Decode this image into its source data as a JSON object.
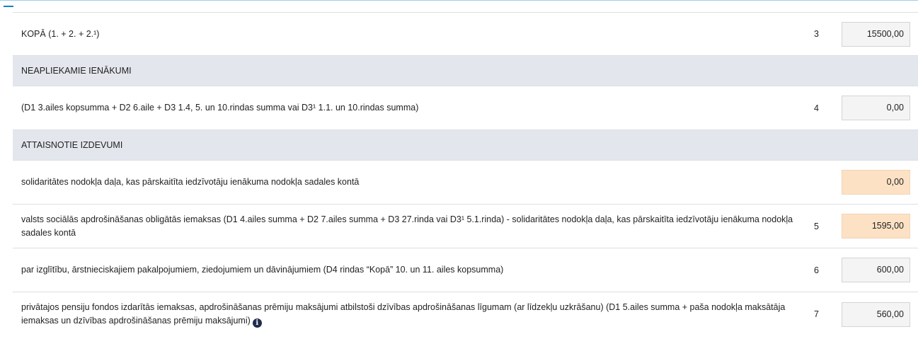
{
  "rows": [
    {
      "kind": "data",
      "label": "KOPĀ (1. + 2. + 2.¹)",
      "num": "3",
      "value": "15500,00"
    },
    {
      "kind": "section",
      "label": "NEAPLIEKAMIE IENĀKUMI"
    },
    {
      "kind": "data",
      "label": "(D1 3.ailes kopsumma + D2 6.aile + D3 1.4, 5. un 10.rindas summa vai D3¹ 1.1. un 10.rindas summa)",
      "num": "4",
      "value": "0,00"
    },
    {
      "kind": "section",
      "label": "ATTAISNOTIE IZDEVUMI"
    },
    {
      "kind": "data",
      "label": "solidaritātes nodokļa daļa, kas pārskaitīta iedzīvotāju ienākuma nodokļa sadales kontā",
      "num": "",
      "value": "0,00"
    },
    {
      "kind": "data",
      "label": "valsts sociālās apdrošināšanas obligātās iemaksas (D1 4.ailes summa + D2 7.ailes summa + D3 27.rinda vai D3¹ 5.1.rinda) - solidaritātes nodokļa daļa, kas pārskaitīta iedzīvotāju ienākuma nodokļa sadales kontā",
      "num": "5",
      "value": "1595,00"
    },
    {
      "kind": "data",
      "label": "par izglītību, ārstnieciskajiem pakalpojumiem, ziedojumiem un dāvinājumiem (D4 rindas “Kopā” 10. un 11. ailes kopsumma)",
      "num": "6",
      "value": "600,00"
    },
    {
      "kind": "data",
      "label": "privātajos pensiju fondos izdarītās iemaksas, apdrošināšanas prēmiju maksājumi atbilstoši dzīvības apdrošināšanas līgumam (ar līdzekļu uzkrāšanu) (D1 5.ailes summa + paša nodokļa maksātāja iemaksas un dzīvības apdrošināšanas prēmiju maksājumi)",
      "num": "7",
      "value": "560,00",
      "info_icon": "info-circle-icon"
    }
  ],
  "colors": {
    "field_bg": "#f4f4f4",
    "highlight_bg": "#fde1c4",
    "section_bg": "#e4e6ee",
    "accent": "#1a7fc4"
  }
}
